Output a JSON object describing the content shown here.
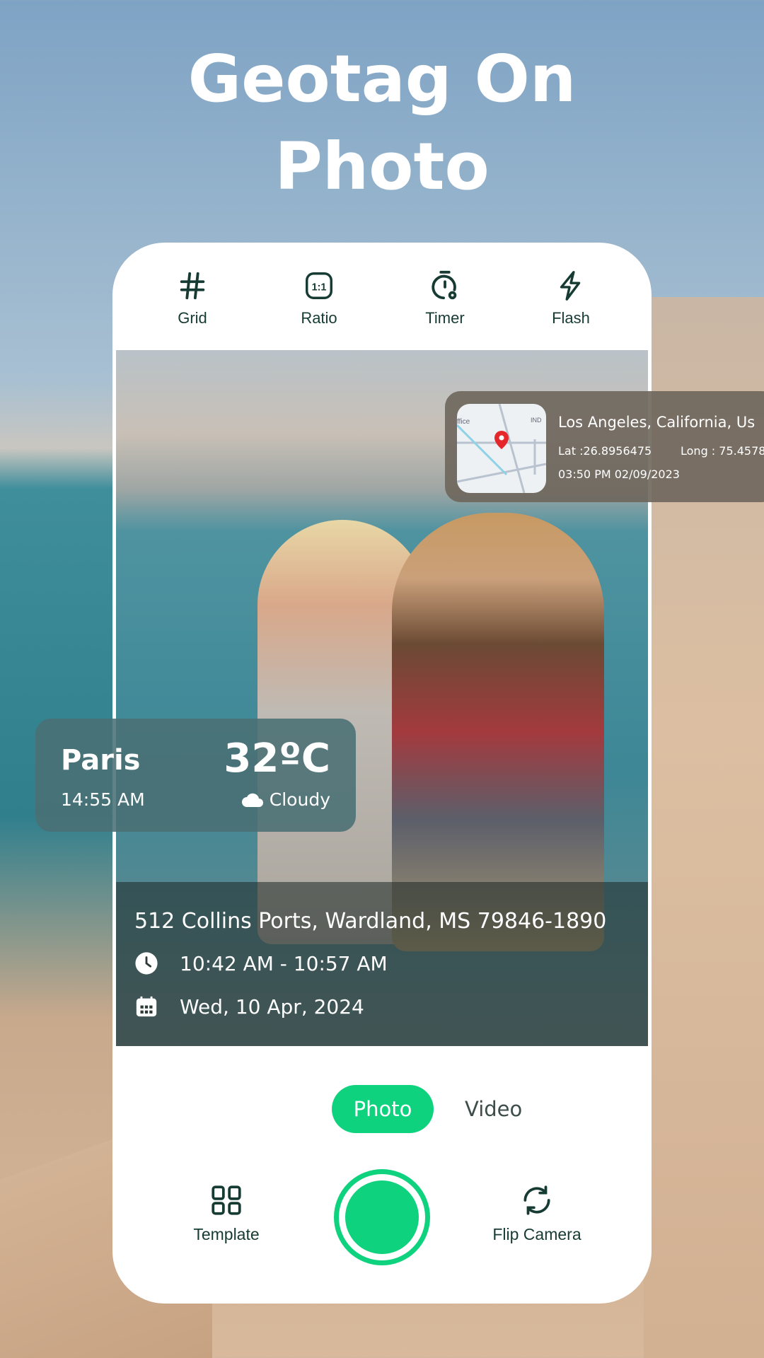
{
  "headline": {
    "line1": "Geotag On",
    "line2": "Photo"
  },
  "toolbar": [
    {
      "label": "Grid",
      "icon": "grid-hash-icon"
    },
    {
      "label": "Ratio",
      "icon": "ratio-icon",
      "icon_text": "1:1"
    },
    {
      "label": "Timer",
      "icon": "timer-icon"
    },
    {
      "label": "Flash",
      "icon": "flash-icon"
    }
  ],
  "location_card": {
    "place": "Los Angeles, California, Us",
    "lat": "Lat :26.8956475",
    "long": "Long : 75.4578",
    "datetime": "03:50 PM 02/09/2023",
    "map_labels": [
      "ffice",
      "IND"
    ]
  },
  "weather_card": {
    "city": "Paris",
    "time": "14:55 AM",
    "temperature": "32ºC",
    "condition": "Cloudy"
  },
  "address_overlay": {
    "address": "512 Collins Ports, Wardland, MS 79846-1890",
    "time_range": "10:42 AM - 10:57 AM",
    "date": "Wed, 10 Apr, 2024"
  },
  "modes": {
    "photo": "Photo",
    "video": "Video",
    "selected": "Photo"
  },
  "bottom": {
    "template": "Template",
    "flip": "Flip Camera"
  },
  "colors": {
    "accent": "#0fd27e",
    "icon": "#163b33"
  }
}
